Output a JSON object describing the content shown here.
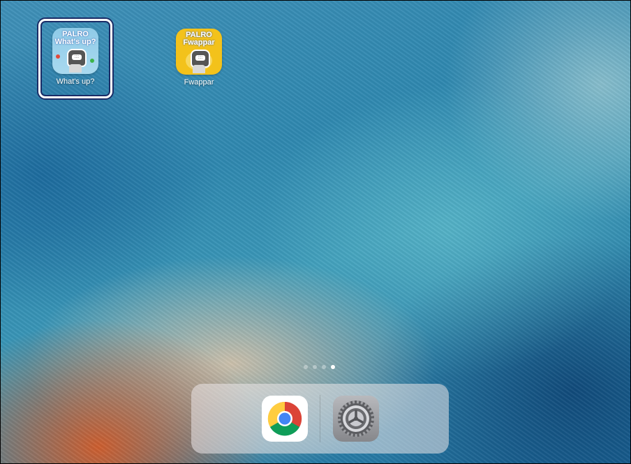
{
  "home_screen": {
    "apps": [
      {
        "label": "What's up?",
        "icon": "palro-whats-up-icon",
        "brand_top": "PALRO",
        "brand_bottom": "What's up?",
        "selected": true
      },
      {
        "label": "Fwappar",
        "icon": "palro-fwappar-icon",
        "brand_top": "PALRO",
        "brand_bottom": "Fwappar",
        "selected": false
      }
    ],
    "page_indicator": {
      "pages": 4,
      "current": 4
    }
  },
  "dock": {
    "apps": [
      {
        "icon": "chrome-icon"
      },
      {
        "icon": "settings-gear-icon"
      }
    ]
  },
  "colors": {
    "selection_ring": "#1a2c66",
    "whats_up_bg": "#8fcbe8",
    "fwappar_bg": "#f3c21b"
  }
}
